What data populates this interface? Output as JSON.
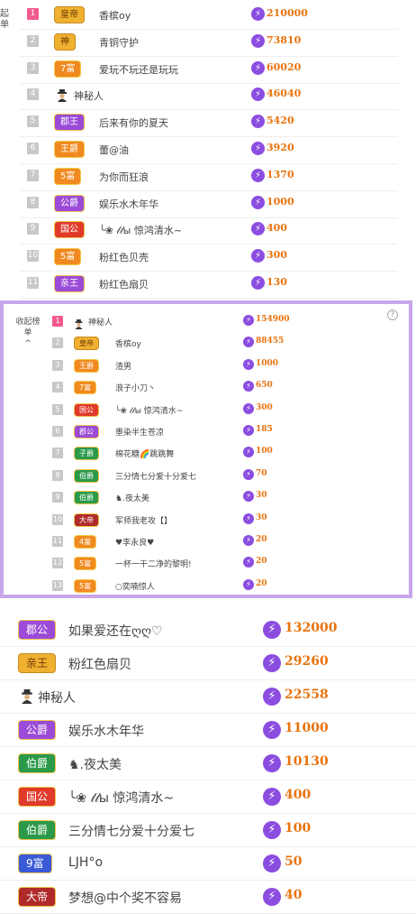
{
  "top_list": {
    "side_label": "起单",
    "rows": [
      {
        "rank": "1",
        "badge": "皇帝",
        "badge_color": "gold",
        "name": "香槟oy",
        "value": "210000",
        "top": true
      },
      {
        "rank": "2",
        "badge": "神",
        "badge_color": "gold",
        "name": "青铜守护",
        "value": "73810"
      },
      {
        "rank": "3",
        "badge": "7富",
        "badge_color": "orange",
        "name": "爱玩不玩还是玩玩",
        "value": "60020"
      },
      {
        "rank": "4",
        "badge": "",
        "badge_color": "",
        "name": "神秘人",
        "value": "46040",
        "mystery": true
      },
      {
        "rank": "5",
        "badge": "郡王",
        "badge_color": "purple",
        "name": "后来有你的夏天",
        "value": "5420"
      },
      {
        "rank": "6",
        "badge": "王爵",
        "badge_color": "orange",
        "name": "蕾@油",
        "value": "3920"
      },
      {
        "rank": "7",
        "badge": "5富",
        "badge_color": "orange",
        "name": "为你而狂浪",
        "value": "1370"
      },
      {
        "rank": "8",
        "badge": "公爵",
        "badge_color": "purple",
        "name": "娱乐水木年华",
        "value": "1000"
      },
      {
        "rank": "9",
        "badge": "国公",
        "badge_color": "red",
        "name": "╰❀ 𝓁𝓁ы 惊鸿清水~",
        "value": "400"
      },
      {
        "rank": "10",
        "badge": "5富",
        "badge_color": "orange",
        "name": "粉红色贝壳",
        "value": "300"
      },
      {
        "rank": "11",
        "badge": "亲王",
        "badge_color": "purple",
        "name": "粉红色扇贝",
        "value": "130"
      }
    ]
  },
  "mid_list": {
    "side_label": "收起榜单",
    "side_arrow": "^",
    "help": "?",
    "rows": [
      {
        "rank": "1",
        "badge": "",
        "badge_color": "",
        "name": "神秘人",
        "value": "154900",
        "top": true,
        "mystery": true
      },
      {
        "rank": "2",
        "badge": "皇帝",
        "badge_color": "gold",
        "name": "香槟oy",
        "value": "88455"
      },
      {
        "rank": "3",
        "badge": "王爵",
        "badge_color": "orange",
        "name": "渣男",
        "value": "1000"
      },
      {
        "rank": "4",
        "badge": "7富",
        "badge_color": "orange",
        "name": "浪子小刀丶",
        "value": "650"
      },
      {
        "rank": "5",
        "badge": "国公",
        "badge_color": "red",
        "name": "╰❀ 𝓁𝓁ы 惊鸿清水~",
        "value": "300"
      },
      {
        "rank": "6",
        "badge": "郡公",
        "badge_color": "purple",
        "name": "墨染半生苍凉",
        "value": "185"
      },
      {
        "rank": "7",
        "badge": "子爵",
        "badge_color": "green",
        "name": "棉花糖🌈跳跳舞",
        "value": "100"
      },
      {
        "rank": "8",
        "badge": "伯爵",
        "badge_color": "green",
        "name": "三分情七分爱十分爱七",
        "value": "70"
      },
      {
        "rank": "9",
        "badge": "伯爵",
        "badge_color": "green",
        "name": "♞.夜太美",
        "value": "30"
      },
      {
        "rank": "10",
        "badge": "大帝",
        "badge_color": "darkred",
        "name": "军师我老攻【】",
        "value": "30"
      },
      {
        "rank": "11",
        "badge": "4富",
        "badge_color": "orange",
        "name": "♥李永良♥",
        "value": "20"
      },
      {
        "rank": "12",
        "badge": "5富",
        "badge_color": "orange",
        "name": "一杯一干二净的黎明!",
        "value": "20"
      },
      {
        "rank": "13",
        "badge": "5富",
        "badge_color": "orange",
        "name": "○奕喃惊人",
        "value": "20"
      }
    ]
  },
  "bottom_list": {
    "rows": [
      {
        "badge": "郡公",
        "badge_color": "purple",
        "name": "如果爱还在ღღ♡",
        "value": "132000"
      },
      {
        "badge": "亲王",
        "badge_color": "gold",
        "name": "粉红色扇贝",
        "value": "29260"
      },
      {
        "badge": "",
        "badge_color": "",
        "name": "神秘人",
        "value": "22558",
        "mystery": true
      },
      {
        "badge": "公爵",
        "badge_color": "purple",
        "name": "娱乐水木年华",
        "value": "11000"
      },
      {
        "badge": "伯爵",
        "badge_color": "green",
        "name": "♞.夜太美",
        "value": "10130"
      },
      {
        "badge": "国公",
        "badge_color": "red",
        "name": "╰❀ 𝓁𝓁ы 惊鸿清水~",
        "value": "400"
      },
      {
        "badge": "伯爵",
        "badge_color": "green",
        "name": "三分情七分爱十分爱七",
        "value": "100"
      },
      {
        "badge": "9富",
        "badge_color": "blue",
        "name": "LJH°o",
        "value": "50"
      },
      {
        "badge": "大帝",
        "badge_color": "darkred",
        "name": "梦想@中个奖不容易",
        "value": "40"
      }
    ]
  },
  "bolt_glyph": "⚡"
}
